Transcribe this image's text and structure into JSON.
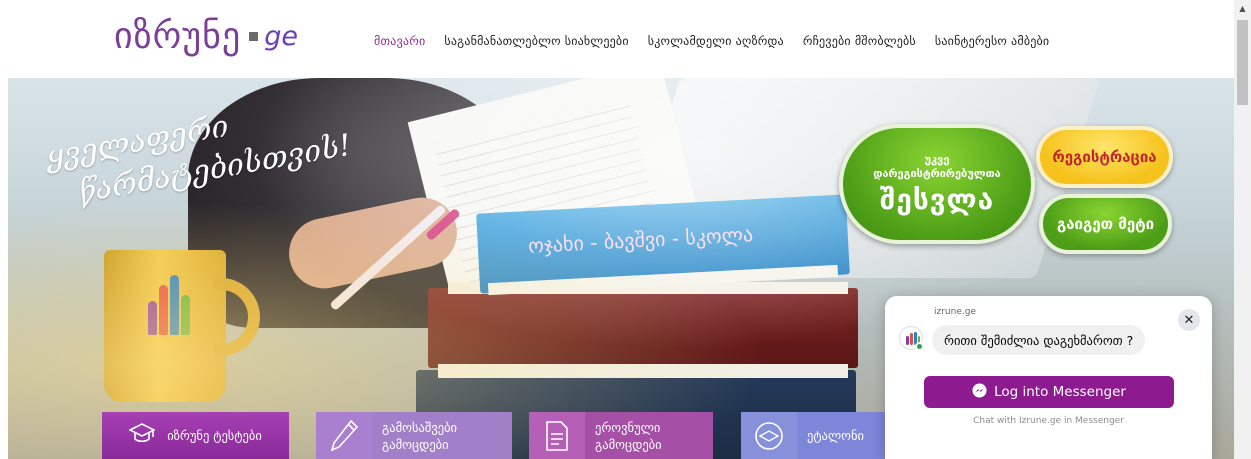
{
  "logo": {
    "word": "იზრუნე",
    "tld": "ge"
  },
  "nav": {
    "items": [
      {
        "label": "მთავარი",
        "active": true
      },
      {
        "label": "საგანმანათლებლო სიახლეები",
        "active": false
      },
      {
        "label": "სკოლამდელი აღზრდა",
        "active": false
      },
      {
        "label": "რჩევები მშობლებს",
        "active": false
      },
      {
        "label": "საინტერესო ამბები",
        "active": false
      }
    ]
  },
  "hero": {
    "slogan_line1": "ყველაფერი",
    "slogan_line2": "წარმატებისთვის!",
    "book_text": "ოჯახი - ბავშვი - სკოლა",
    "login_button": {
      "top": "უკვე",
      "middle": "დარეგისტრირებულთა",
      "main": "შესვლა"
    },
    "register_button": "რეგისტრაცია",
    "more_button": "გაიგეთ მეტი"
  },
  "tiles": [
    {
      "icon": "graduation-cap-icon",
      "label": "იზრუნე ტესტები"
    },
    {
      "icon": "pencil-icon",
      "label_line1": "გამოსაშვები",
      "label_line2": "გამოცდები"
    },
    {
      "icon": "document-icon",
      "label_line1": "ეროვნული",
      "label_line2": "გამოცდები"
    },
    {
      "icon": "certificate-icon",
      "label": "ეტალონი"
    }
  ],
  "chat": {
    "page_name": "izrune.ge",
    "message": "რითი შემიძლია დაგეხმაროთ ?",
    "login_button": "Log into Messenger",
    "footer": "Chat with Izrune.ge in Messenger",
    "close_symbol": "✕"
  },
  "colors": {
    "brand_purple": "#7b3f98",
    "nav_active": "#8e2c9c",
    "green_button": "#4d9e17",
    "yellow_button": "#f6c21b",
    "messenger_button": "#8d1a8e"
  }
}
